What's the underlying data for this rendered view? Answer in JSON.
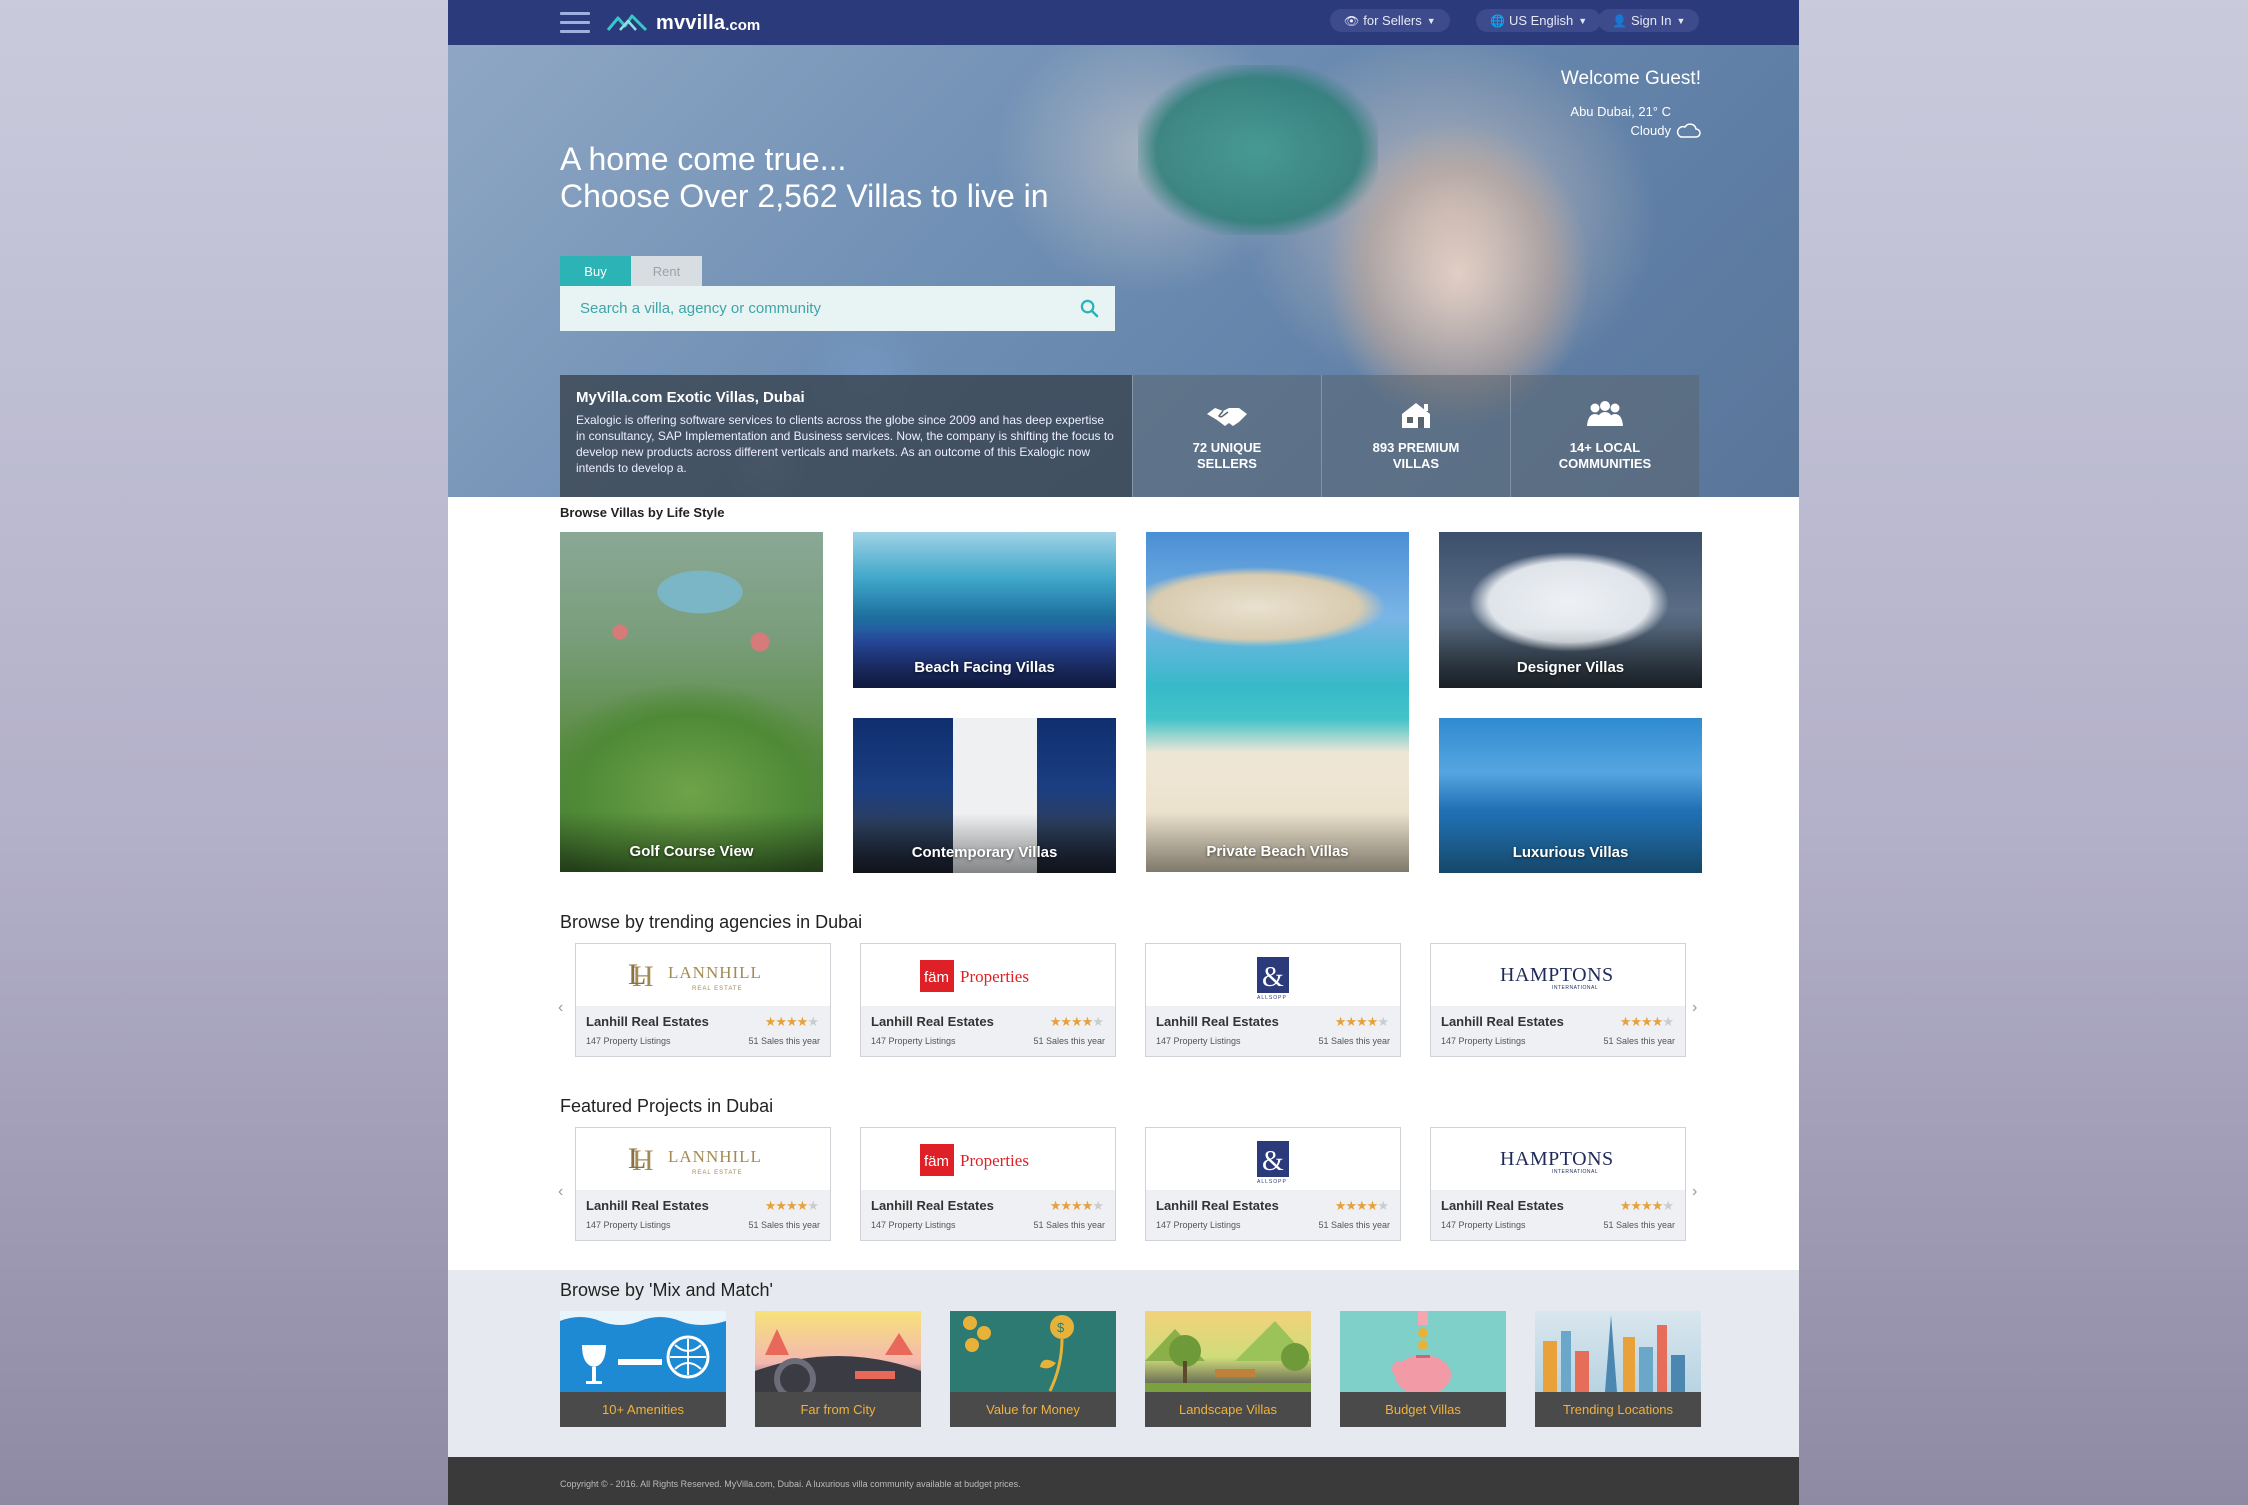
{
  "nav": {
    "brand_name": "mvvilla",
    "brand_tld": ".com",
    "sellers_label": "for Sellers",
    "language_label": "US English",
    "signin_label": "Sign In"
  },
  "hero": {
    "title_line1": "A home come true...",
    "title_line2": "Choose Over 2,562 Villas to live in",
    "welcome": "Welcome Guest!",
    "weather_line1": "Abu Dubai, 21° C",
    "weather_line2": "Cloudy",
    "tabs": [
      "Buy",
      "Rent"
    ],
    "search_placeholder": "Search a villa, agency or community",
    "about_title": "MyVilla.com Exotic Villas, Dubai",
    "about_text": "Exalogic is offering software services to clients across the globe since 2009 and has deep expertise in consultancy, SAP Implementation and Business services. Now, the company is shifting the focus to develop new products across different verticals and markets. As an outcome of this Exalogic now intends to develop a.",
    "stats": [
      "72 UNIQUE SELLERS",
      "893 PREMIUM VILLAS",
      "14+ LOCAL COMMUNITIES"
    ]
  },
  "lifestyle": {
    "heading": "Browse Villas by Life Style",
    "tiles": [
      "Golf Course View",
      "Beach Facing Villas",
      "Contemporary Villas",
      "Private Beach Villas",
      "Designer Villas",
      "Luxurious Villas"
    ]
  },
  "agencies": {
    "heading": "Browse by trending agencies in Dubai",
    "cards": [
      {
        "logo": "LANNHILL",
        "logo_sub": "REAL ESTATE",
        "name": "Lanhill Real Estates",
        "listings": "147 Property Listings",
        "sales": "51 Sales this year",
        "rating": 4
      },
      {
        "logo": "fäm",
        "logo_sub": "Properties",
        "name": "Lanhill Real Estates",
        "listings": "147 Property Listings",
        "sales": "51 Sales this year",
        "rating": 4
      },
      {
        "logo": "&",
        "logo_sub": "ALLSOPP",
        "name": "Lanhill Real Estates",
        "listings": "147 Property Listings",
        "sales": "51 Sales this year",
        "rating": 4
      },
      {
        "logo": "HAMPTONS",
        "logo_sub": "INTERNATIONAL",
        "name": "Lanhill Real Estates",
        "listings": "147 Property Listings",
        "sales": "51 Sales this year",
        "rating": 4
      }
    ]
  },
  "projects": {
    "heading": "Featured Projects in Dubai",
    "cards": [
      {
        "logo": "LANNHILL",
        "logo_sub": "REAL ESTATE",
        "name": "Lanhill Real Estates",
        "listings": "147 Property Listings",
        "sales": "51 Sales this year",
        "rating": 4
      },
      {
        "logo": "fäm",
        "logo_sub": "Properties",
        "name": "Lanhill Real Estates",
        "listings": "147 Property Listings",
        "sales": "51 Sales this year",
        "rating": 4
      },
      {
        "logo": "&",
        "logo_sub": "ALLSOPP",
        "name": "Lanhill Real Estates",
        "listings": "147 Property Listings",
        "sales": "51 Sales this year",
        "rating": 4
      },
      {
        "logo": "HAMPTONS",
        "logo_sub": "INTERNATIONAL",
        "name": "Lanhill Real Estates",
        "listings": "147 Property Listings",
        "sales": "51 Sales this year",
        "rating": 4
      }
    ]
  },
  "mix": {
    "heading": "Browse by 'Mix and Match'",
    "items": [
      "10+ Amenities",
      "Far from City",
      "Value for Money",
      "Landscape Villas",
      "Budget Villas",
      "Trending Locations"
    ]
  },
  "footer": {
    "copyright": "Copyright © - 2016. All Rights Reserved. MyVilla.com, Dubai. A luxurious villa community available at budget prices."
  },
  "colors": {
    "nav_bg": "#2b3a7a",
    "accent_teal": "#2bb3b6",
    "star_gold": "#e8a13a",
    "mix_label": "#f1b13a",
    "footer_bg": "#3a3a3a"
  }
}
